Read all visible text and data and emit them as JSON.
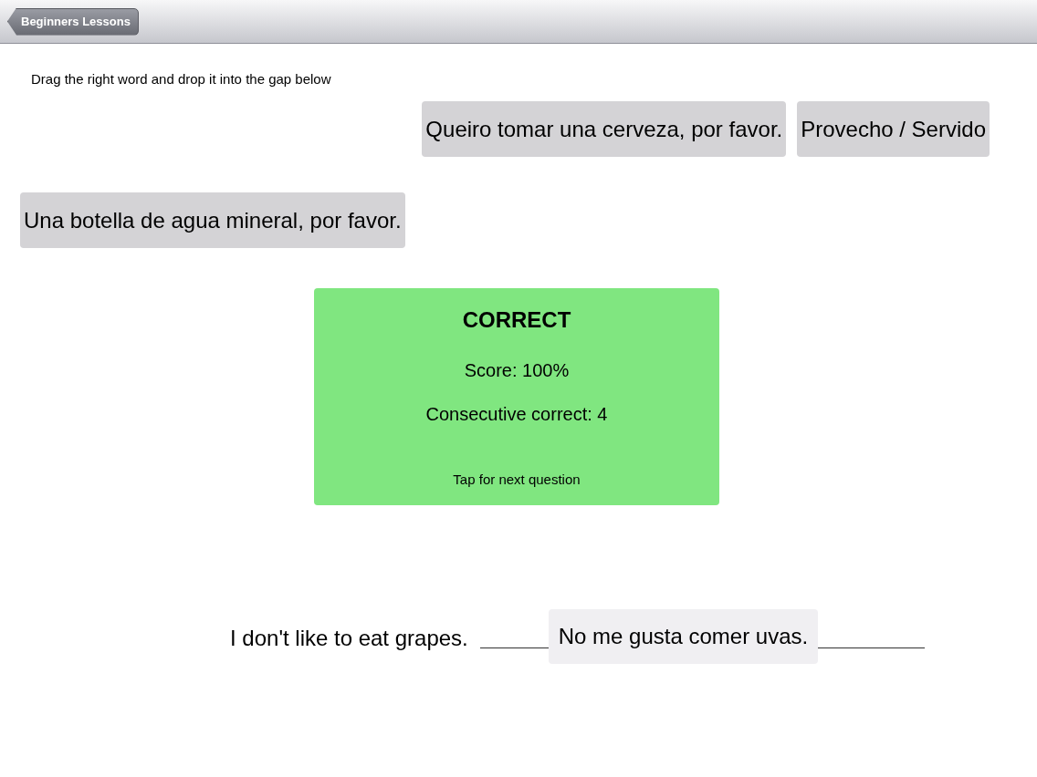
{
  "nav_bar": {
    "back_button": "Beginners Lessons"
  },
  "instruction": "Drag the right word and drop it into the gap below",
  "word_tiles": [
    {
      "text": "Queiro tomar una cerveza, por favor."
    },
    {
      "text": "Provecho / Servido"
    },
    {
      "text": "Una botella de agua mineral, por favor."
    }
  ],
  "feedback": {
    "kind": "correct",
    "title": "CORRECT",
    "score": "Score: 100%",
    "streak": "Consecutive correct: 4",
    "hint": "Tap for next question"
  },
  "question": {
    "prompt": "I don't like to eat grapes.",
    "answer": "No me gusta comer uvas."
  }
}
